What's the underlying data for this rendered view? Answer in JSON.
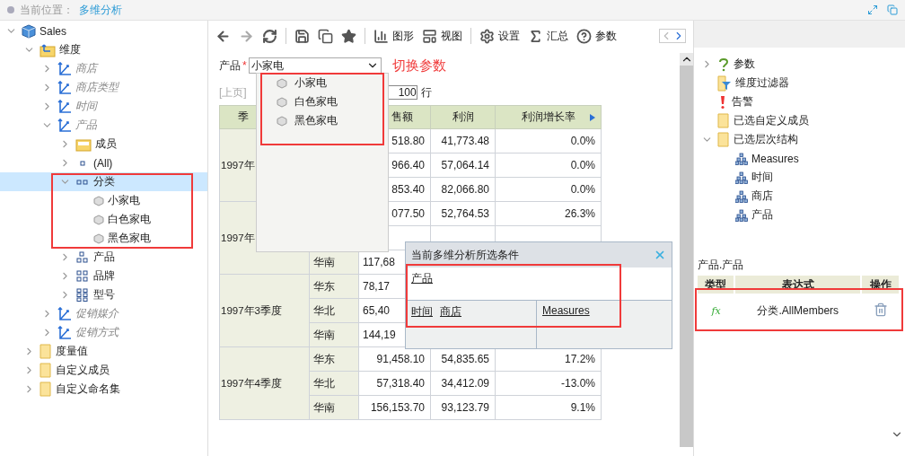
{
  "breadcrumb": {
    "label": "当前位置：",
    "current": "多维分析"
  },
  "tree": [
    {
      "label": "Sales",
      "kind": "cube",
      "expanded": true,
      "selected": false,
      "children": [
        {
          "label": "维度",
          "kind": "dimfolder",
          "expanded": true,
          "selected": false,
          "children": [
            {
              "label": "商店",
              "kind": "dimension",
              "expanded": false,
              "selected": false
            },
            {
              "label": "商店类型",
              "kind": "dimension",
              "expanded": false,
              "selected": false
            },
            {
              "label": "时间",
              "kind": "dimension",
              "expanded": false,
              "selected": false
            },
            {
              "label": "产品",
              "kind": "dimension",
              "expanded": true,
              "selected": false,
              "children": [
                {
                  "label": "成员",
                  "kind": "memberfolder",
                  "expanded": false,
                  "selected": false
                },
                {
                  "label": "(All)",
                  "kind": "single",
                  "expanded": false,
                  "selected": false
                },
                {
                  "label": "分类",
                  "kind": "pair",
                  "expanded": true,
                  "selected": true,
                  "children": [
                    {
                      "label": "小家电",
                      "kind": "member",
                      "selected": false
                    },
                    {
                      "label": "白色家电",
                      "kind": "member",
                      "selected": false
                    },
                    {
                      "label": "黑色家电",
                      "kind": "member",
                      "selected": false
                    }
                  ]
                },
                {
                  "label": "产品",
                  "kind": "triad",
                  "expanded": false,
                  "selected": false
                },
                {
                  "label": "品牌",
                  "kind": "quad",
                  "expanded": false,
                  "selected": false
                },
                {
                  "label": "型号",
                  "kind": "six",
                  "expanded": false,
                  "selected": false
                }
              ]
            },
            {
              "label": "促销媒介",
              "kind": "dimension",
              "expanded": false,
              "selected": false
            },
            {
              "label": "促销方式",
              "kind": "dimension",
              "expanded": false,
              "selected": false
            }
          ]
        },
        {
          "label": "度量值",
          "kind": "folder",
          "expanded": false,
          "selected": false
        },
        {
          "label": "自定义成员",
          "kind": "folder",
          "expanded": false,
          "selected": false
        },
        {
          "label": "自定义命名集",
          "kind": "folder",
          "expanded": false,
          "selected": false
        }
      ]
    }
  ],
  "toolbar": [
    {
      "kind": "back",
      "disabled": false
    },
    {
      "kind": "forward",
      "disabled": true
    },
    {
      "kind": "refresh",
      "disabled": false
    },
    {
      "kind": "divider"
    },
    {
      "kind": "save",
      "disabled": false
    },
    {
      "kind": "saveas",
      "disabled": false
    },
    {
      "kind": "star",
      "disabled": false
    },
    {
      "kind": "divider"
    },
    {
      "kind": "chart",
      "label": "图形",
      "disabled": false
    },
    {
      "kind": "view",
      "label": "视图",
      "disabled": false
    },
    {
      "kind": "divider"
    },
    {
      "kind": "settings",
      "label": "设置",
      "disabled": false
    },
    {
      "kind": "sum",
      "label": "汇总",
      "disabled": false
    },
    {
      "kind": "param",
      "label": "参数",
      "disabled": false
    }
  ],
  "parameter": {
    "label": "产品",
    "required_mark": "*",
    "value": "小家电",
    "note": "切换参数",
    "options": [
      {
        "label": "小家电"
      },
      {
        "label": "白色家电"
      },
      {
        "label": "黑色家电"
      }
    ]
  },
  "pager": {
    "prev": "[上页]",
    "page_size": "100",
    "unit": "行"
  },
  "table": {
    "columns": [
      "季",
      null,
      "售额",
      "利润",
      "利润增长率"
    ],
    "groups": [
      {
        "quarter": "1997年",
        "rows": [
          {
            "region": null,
            "sales": "518.80",
            "profit": "41,773.48",
            "growth": "0.0%"
          },
          {
            "region": null,
            "sales": "966.40",
            "profit": "57,064.14",
            "growth": "0.0%"
          },
          {
            "region": null,
            "sales": "853.40",
            "profit": "82,066.80",
            "growth": "0.0%"
          }
        ]
      },
      {
        "quarter": "1997年",
        "rows": [
          {
            "region": null,
            "sales": "077.50",
            "profit": "52,764.53",
            "growth": "26.3%"
          },
          {
            "region": null,
            "sales": null,
            "profit": null,
            "growth": null
          },
          {
            "region": "华南",
            "sales": "117,68",
            "profit": null,
            "growth": null
          }
        ]
      },
      {
        "quarter": "1997年3季度",
        "rows": [
          {
            "region": "华东",
            "sales": "78,17",
            "profit": null,
            "growth": null
          },
          {
            "region": "华北",
            "sales": "65,40",
            "profit": null,
            "growth": null
          },
          {
            "region": "华南",
            "sales": "144,19",
            "profit": null,
            "growth": null
          }
        ]
      },
      {
        "quarter": "1997年4季度",
        "rows": [
          {
            "region": "华东",
            "sales": "91,458.10",
            "profit": "54,835.65",
            "growth": "17.2%"
          },
          {
            "region": "华北",
            "sales": "57,318.40",
            "profit": "34,412.09",
            "growth": "-13.0%"
          },
          {
            "region": "华南",
            "sales": "156,153.70",
            "profit": "93,123.79",
            "growth": "9.1%"
          }
        ]
      }
    ]
  },
  "conditions": {
    "title": "当前多维分析所选条件",
    "filter": [
      "产品"
    ],
    "rows": [
      "时间",
      "商店"
    ],
    "columns": [
      "Measures"
    ]
  },
  "structure": [
    {
      "label": "参数",
      "kind": "question",
      "expanded": false
    },
    {
      "label": "维度过滤器",
      "kind": "filter"
    },
    {
      "label": "告警",
      "kind": "alert"
    },
    {
      "label": "已选自定义成员",
      "kind": "folder"
    },
    {
      "label": "已选层次结构",
      "kind": "folder",
      "expanded": true,
      "children": [
        {
          "label": "Measures",
          "kind": "hierarchy"
        },
        {
          "label": "时间",
          "kind": "hierarchy"
        },
        {
          "label": "商店",
          "kind": "hierarchy"
        },
        {
          "label": "产品",
          "kind": "hierarchy"
        }
      ]
    }
  ],
  "expression_panel": {
    "title": "产品.产品",
    "columns": [
      "类型",
      "表达式",
      "操作"
    ],
    "rows": [
      {
        "type": "fx",
        "expression": "分类.AllMembers"
      }
    ]
  }
}
